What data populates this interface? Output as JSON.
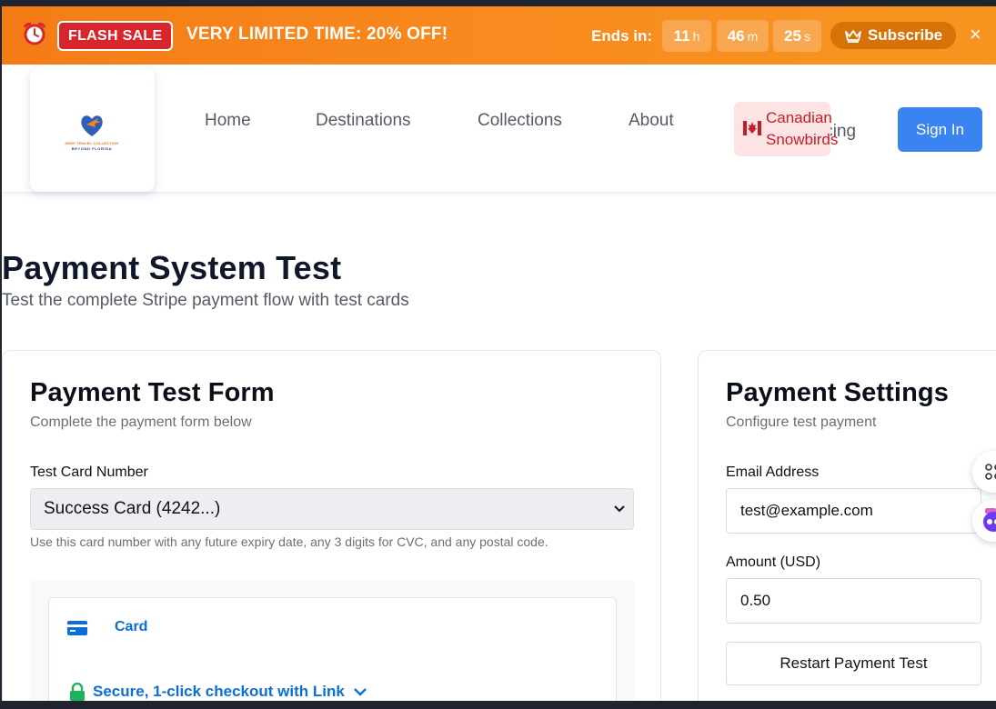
{
  "banner": {
    "sale_badge": "FLASH SALE",
    "promo_text": "VERY LIMITED TIME:  20% OFF!",
    "ends_label": "Ends in:",
    "hours": "11",
    "hours_unit": "h",
    "minutes": "46",
    "minutes_unit": "m",
    "seconds": "25",
    "seconds_unit": "s",
    "subscribe_label": "Subscribe",
    "close_label": "×"
  },
  "logo": {
    "line1": "DEEP TRAVEL COLLECTION",
    "line2": "BEYOND FLORIDA"
  },
  "nav": {
    "items": [
      "Home",
      "Destinations",
      "Collections",
      "About"
    ],
    "canadian_line1": "Canadian",
    "canadian_line2": "Snowbirds",
    "pricing_partial": "icing",
    "signin": "Sign In"
  },
  "page": {
    "title": "Payment System Test",
    "subtitle": "Test the complete Stripe payment flow with test cards"
  },
  "form": {
    "title": "Payment Test Form",
    "description": "Complete the payment form below",
    "card_number_label": "Test Card Number",
    "card_number_value": "Success Card (4242...)",
    "hint": "Use this card number with any future expiry date, any 3 digits for CVC, and any postal code.",
    "card_tab": "Card",
    "link_text": "Secure, 1-click checkout with Link"
  },
  "settings": {
    "title": "Payment Settings",
    "description": "Configure test payment",
    "email_label": "Email Address",
    "email_value": "test@example.com",
    "amount_label": "Amount (USD)",
    "amount_value": "0.50",
    "restart_label": "Restart Payment Test"
  },
  "colors": {
    "banner_orange": "#f47c16",
    "sale_red": "#d8262c",
    "signin_blue": "#3a84f2",
    "stripe_blue": "#0a6fdb",
    "canadian_red": "#c41e2a",
    "lock_green": "#1eb35a"
  }
}
